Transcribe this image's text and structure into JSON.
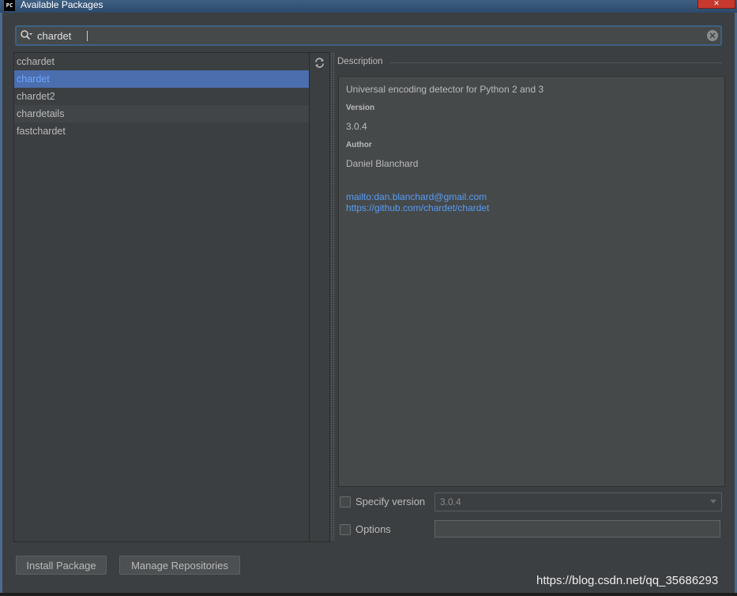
{
  "window": {
    "title": "Available Packages",
    "app_icon_text": "PC",
    "close_glyph": "✕"
  },
  "search": {
    "value": "chardet"
  },
  "packages": [
    {
      "name": "cchardet"
    },
    {
      "name": "chardet",
      "selected": true
    },
    {
      "name": "chardet2"
    },
    {
      "name": "chardetails"
    },
    {
      "name": "fastchardet"
    }
  ],
  "description": {
    "header": "Description",
    "summary": "Universal encoding detector for Python 2 and 3",
    "version_label": "Version",
    "version": "3.0.4",
    "author_label": "Author",
    "author": "Daniel Blanchard",
    "email_link": "mailto:dan.blanchard@gmail.com",
    "homepage_link": "https://github.com/chardet/chardet"
  },
  "options": {
    "specify_version_label": "Specify version",
    "specify_version_value": "3.0.4",
    "options_label": "Options",
    "options_value": ""
  },
  "buttons": {
    "install": "Install Package",
    "manage": "Manage Repositories"
  },
  "watermark": "https://blog.csdn.net/qq_35686293",
  "colors": {
    "background": "#3c3f41",
    "selection": "#4b6eaf",
    "link": "#589df6"
  }
}
